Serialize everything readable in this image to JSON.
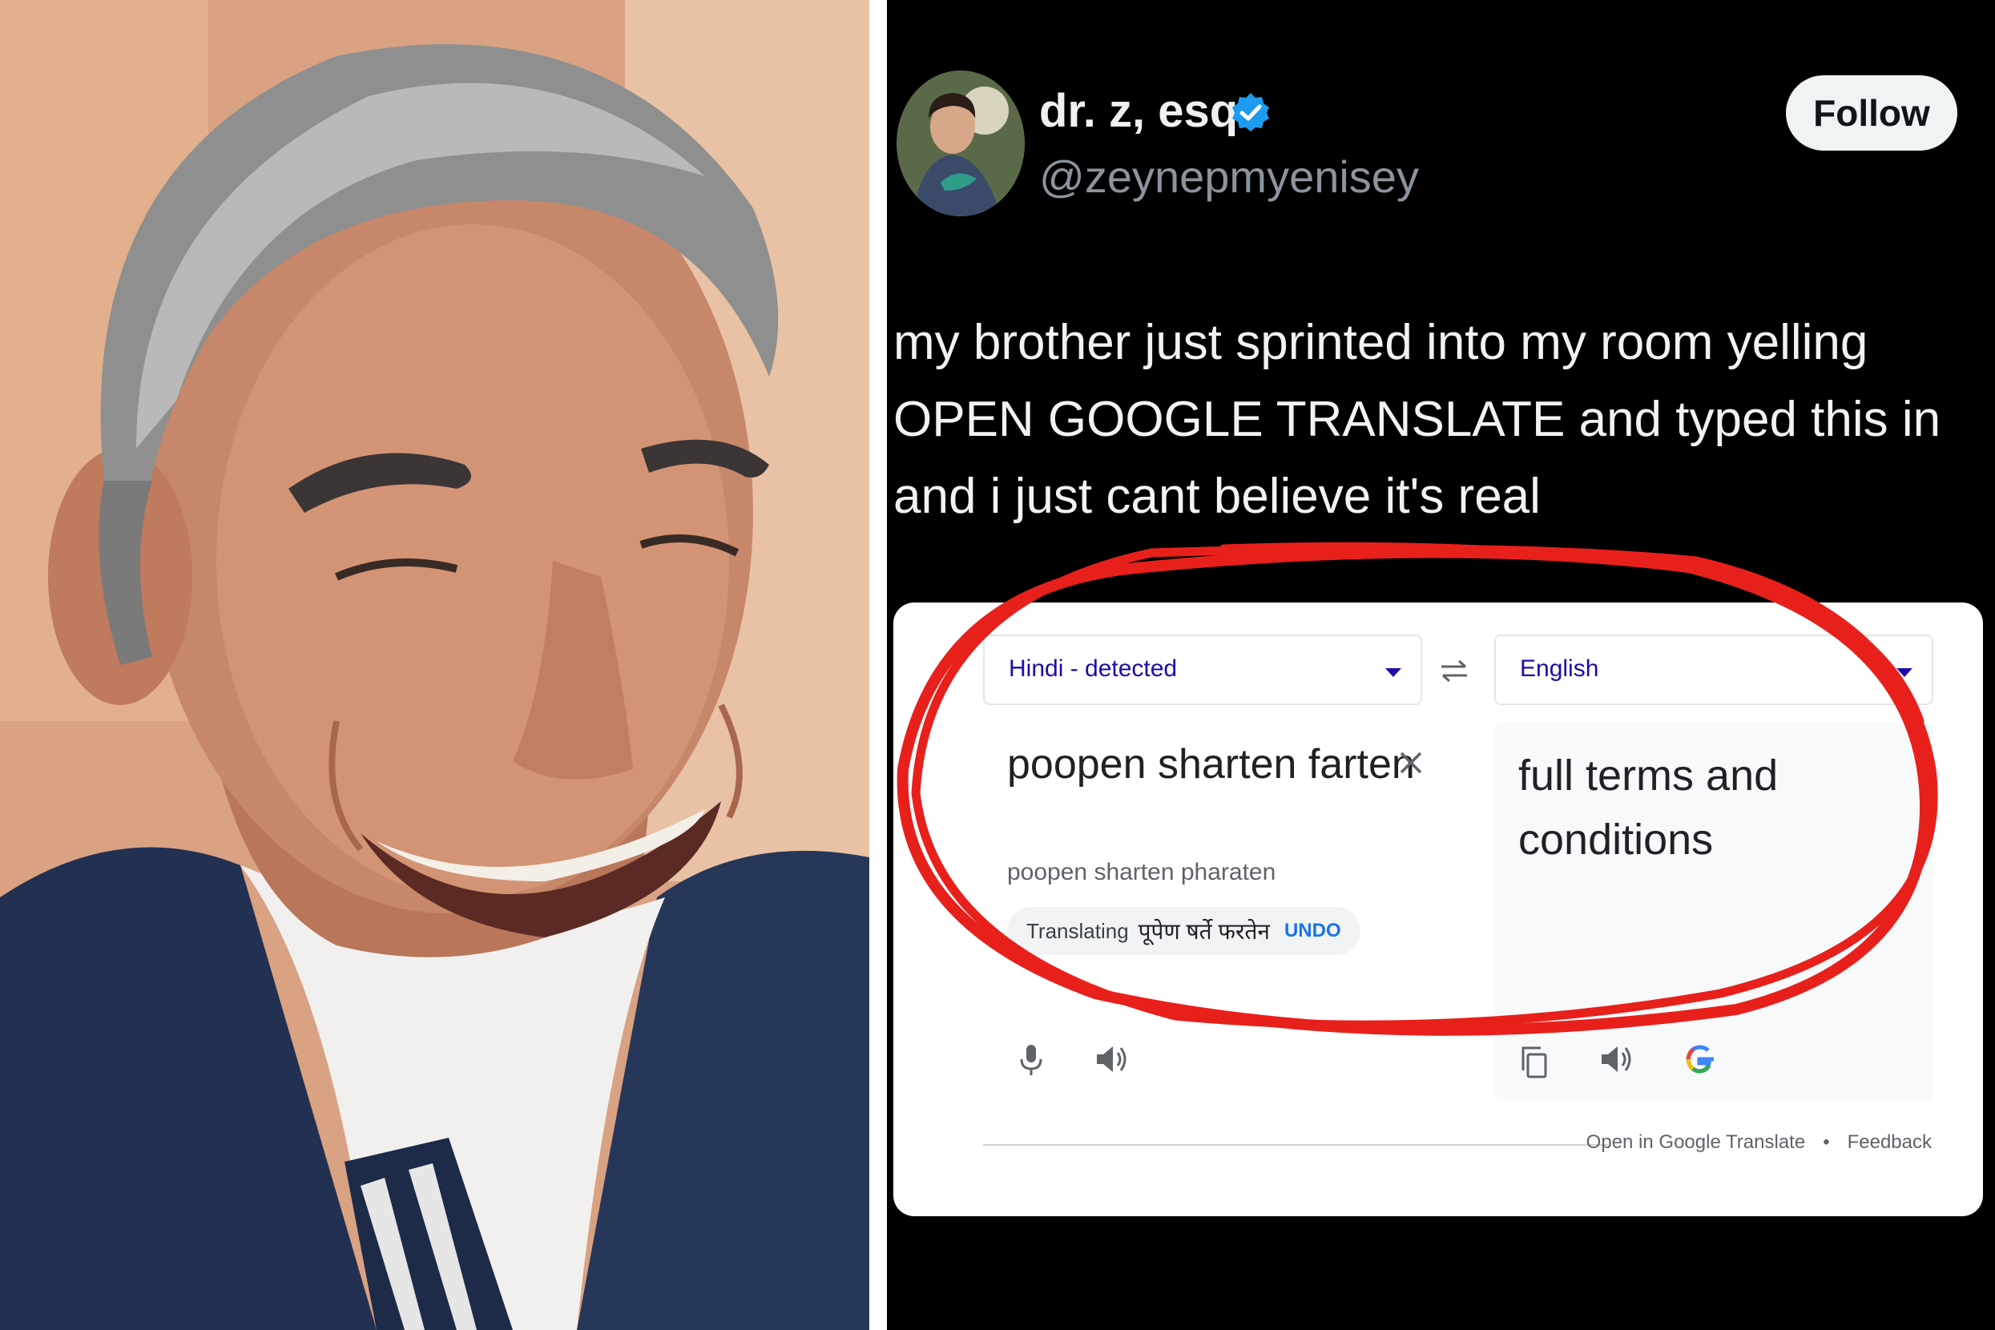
{
  "tweet": {
    "display_name": "dr. z, esq.",
    "handle": "@zeynepmyenisey",
    "follow_label": "Follow",
    "text": "my brother just sprinted into my room yelling OPEN GOOGLE TRANSLATE and typed this in and i just cant believe it's real",
    "icons": {
      "verified": "verified-badge-icon",
      "avatar": "avatar"
    }
  },
  "translate": {
    "source_language": "Hindi - detected",
    "target_language": "English",
    "source_text": "poopen sharten farten",
    "romanization": "poopen sharten pharaten",
    "translating_label": "Translating",
    "translating_devanagari": "पूपेण षर्ते फरतेन",
    "undo_label": "UNDO",
    "target_text": "full terms and conditions",
    "footer": {
      "open_link": "Open in Google Translate",
      "separator": "•",
      "feedback": "Feedback"
    },
    "icons": [
      "swap-languages-icon",
      "clear-icon",
      "microphone-icon",
      "speaker-icon",
      "copy-icon",
      "google-logo-icon"
    ]
  },
  "colors": {
    "tweet_background": "#000000",
    "verified_blue": "#1d9bf0",
    "language_blue": "#1a0dab",
    "undo_blue": "#1a73e8",
    "annotation_red": "#e8201c"
  }
}
